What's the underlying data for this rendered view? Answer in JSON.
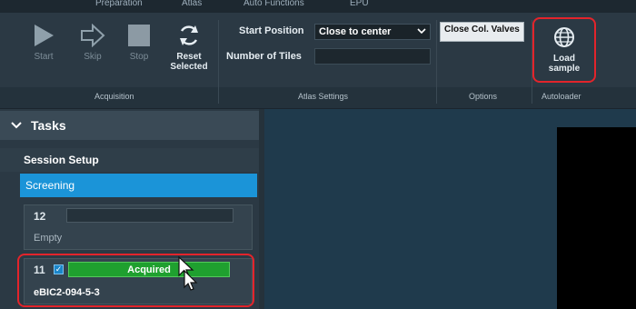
{
  "tabs": [
    {
      "label": "Preparation"
    },
    {
      "label": "Atlas"
    },
    {
      "label": "Auto Functions"
    },
    {
      "label": "EPU"
    }
  ],
  "acquisition": {
    "start_label": "Start",
    "skip_label": "Skip",
    "stop_label": "Stop",
    "reset_label_line1": "Reset",
    "reset_label_line2": "Selected",
    "group_label": "Acquisition"
  },
  "atlas_settings": {
    "start_position_label": "Start Position",
    "start_position_value": "Close to center",
    "number_of_tiles_label": "Number of Tiles",
    "number_of_tiles_value": "",
    "group_label": "Atlas Settings"
  },
  "options": {
    "close_valves_label": "Close Col. Valves",
    "group_label": "Options"
  },
  "autoloader": {
    "load_sample_line1": "Load",
    "load_sample_line2": "sample",
    "group_label": "Autoloader"
  },
  "tasks": {
    "header": "Tasks",
    "session_setup": "Session Setup",
    "screening": "Screening",
    "slots": [
      {
        "number": "12",
        "status": "",
        "name": "Empty",
        "checked": false
      },
      {
        "number": "11",
        "status": "Acquired",
        "name": "eBIC2-094-5-3",
        "checked": true
      }
    ]
  },
  "colors": {
    "ribbon": "#2b3944",
    "selection": "#1b94d8",
    "acquired": "#1fa02f",
    "highlight": "#e3242b",
    "workspace": "#1f3a4c"
  }
}
